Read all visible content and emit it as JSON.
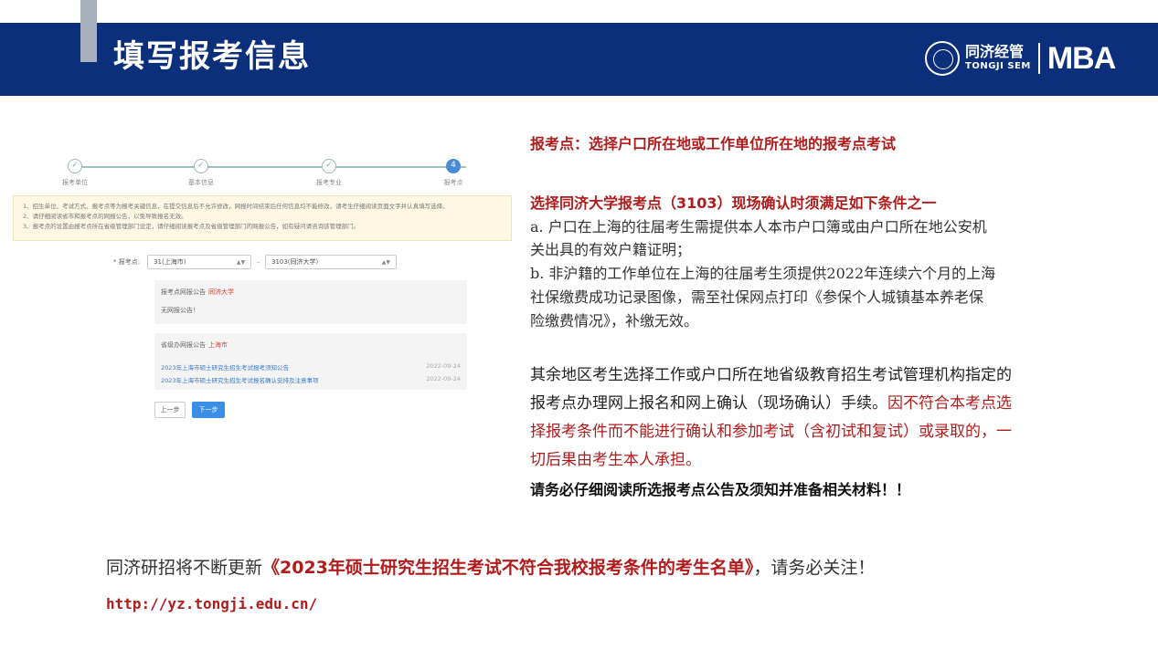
{
  "header": {
    "title": "填写报考信息",
    "logo_cn": "同济经管",
    "logo_en": "TONGJI SEM",
    "logo_mba": "MBA"
  },
  "form_screenshot": {
    "steps": [
      {
        "label": "报考单位",
        "state": "done"
      },
      {
        "label": "基本信息",
        "state": "done"
      },
      {
        "label": "报考专业",
        "state": "done"
      },
      {
        "label": "报考点",
        "state": "active",
        "number": "4"
      }
    ],
    "notices": [
      "1、招生单位、考试方式、报考点等为报考关键信息，在提交信息后不允许修改，网报时间结束后任何信息均不能修改，请考生仔细阅读页面文字并认真填写选择。",
      "2、请仔细阅读省市和报考点的网报公告，以免导致报名无效。",
      "3、报考点的设置由报考点所在省级管理部门设定，请仔细阅读报考点及省级管理部门的网报公告，如有疑问请咨询该管理部门。"
    ],
    "site_label": "* 报考点:",
    "province_select": "31(上海市)",
    "site_select": "3103(同济大学)",
    "site_notice_title": "报考点网报公告",
    "site_notice_name": "同济大学",
    "site_notice_body": "无网报公告！",
    "prov_notice_title": "省级办网报公告",
    "prov_notice_name": "上海市",
    "announcements": [
      {
        "title": "2023年上海市硕士研究生招生考试报考须知公告",
        "date": "2022-09-24"
      },
      {
        "title": "2023年上海市硕士研究生招生考试报名确认安排及注意事项",
        "date": "2022-09-24"
      }
    ],
    "prev_button": "上一步",
    "next_button": "下一步"
  },
  "right": {
    "heading1": "报考点：选择户口所在地或工作单位所在地的报考点考试",
    "heading2": "选择同济大学报考点（3103）现场确认时须满足如下条件之一",
    "cond_a_1": "a. 户口在上海的往届考生需提供本人本市户口簿或由户口所在地公安机",
    "cond_a_2": "关出具的有效户籍证明；",
    "cond_b_1": "b. 非沪籍的工作单位在上海的往届考生须提供2022年连续六个月的上海",
    "cond_b_2": "社保缴费成功记录图像，需至社保网点打印《参保个人城镇基本养老保",
    "cond_b_3": "险缴费情况》，补缴无效。",
    "para_1": "其余地区考生选择工作或户口所在地省级教育招生考试管理机构指定的",
    "para_2a": "报考点办理网上报名和网上确认（现场确认）手续。",
    "para_2b": "因不符合本考点选",
    "para_3": "择报考条件而不能进行确认和参加考试（含初试和复试）或录取的，一",
    "para_4": "切后果由考生本人承担。",
    "reminder": "请务必仔细阅读所选报考点公告及须知并准备相关材料！！"
  },
  "bottom": {
    "prefix": "同济研招将不断更新",
    "highlight": "《2023年硕士研究生招生考试不符合我校报考条件的考生名单》",
    "suffix": "，请务必关注！",
    "url": "http://yz.tongji.edu.cn/"
  },
  "colors": {
    "header_blue": "#0b2f7a",
    "accent_red": "#b01c1c",
    "link_blue": "#3a8ee6"
  }
}
